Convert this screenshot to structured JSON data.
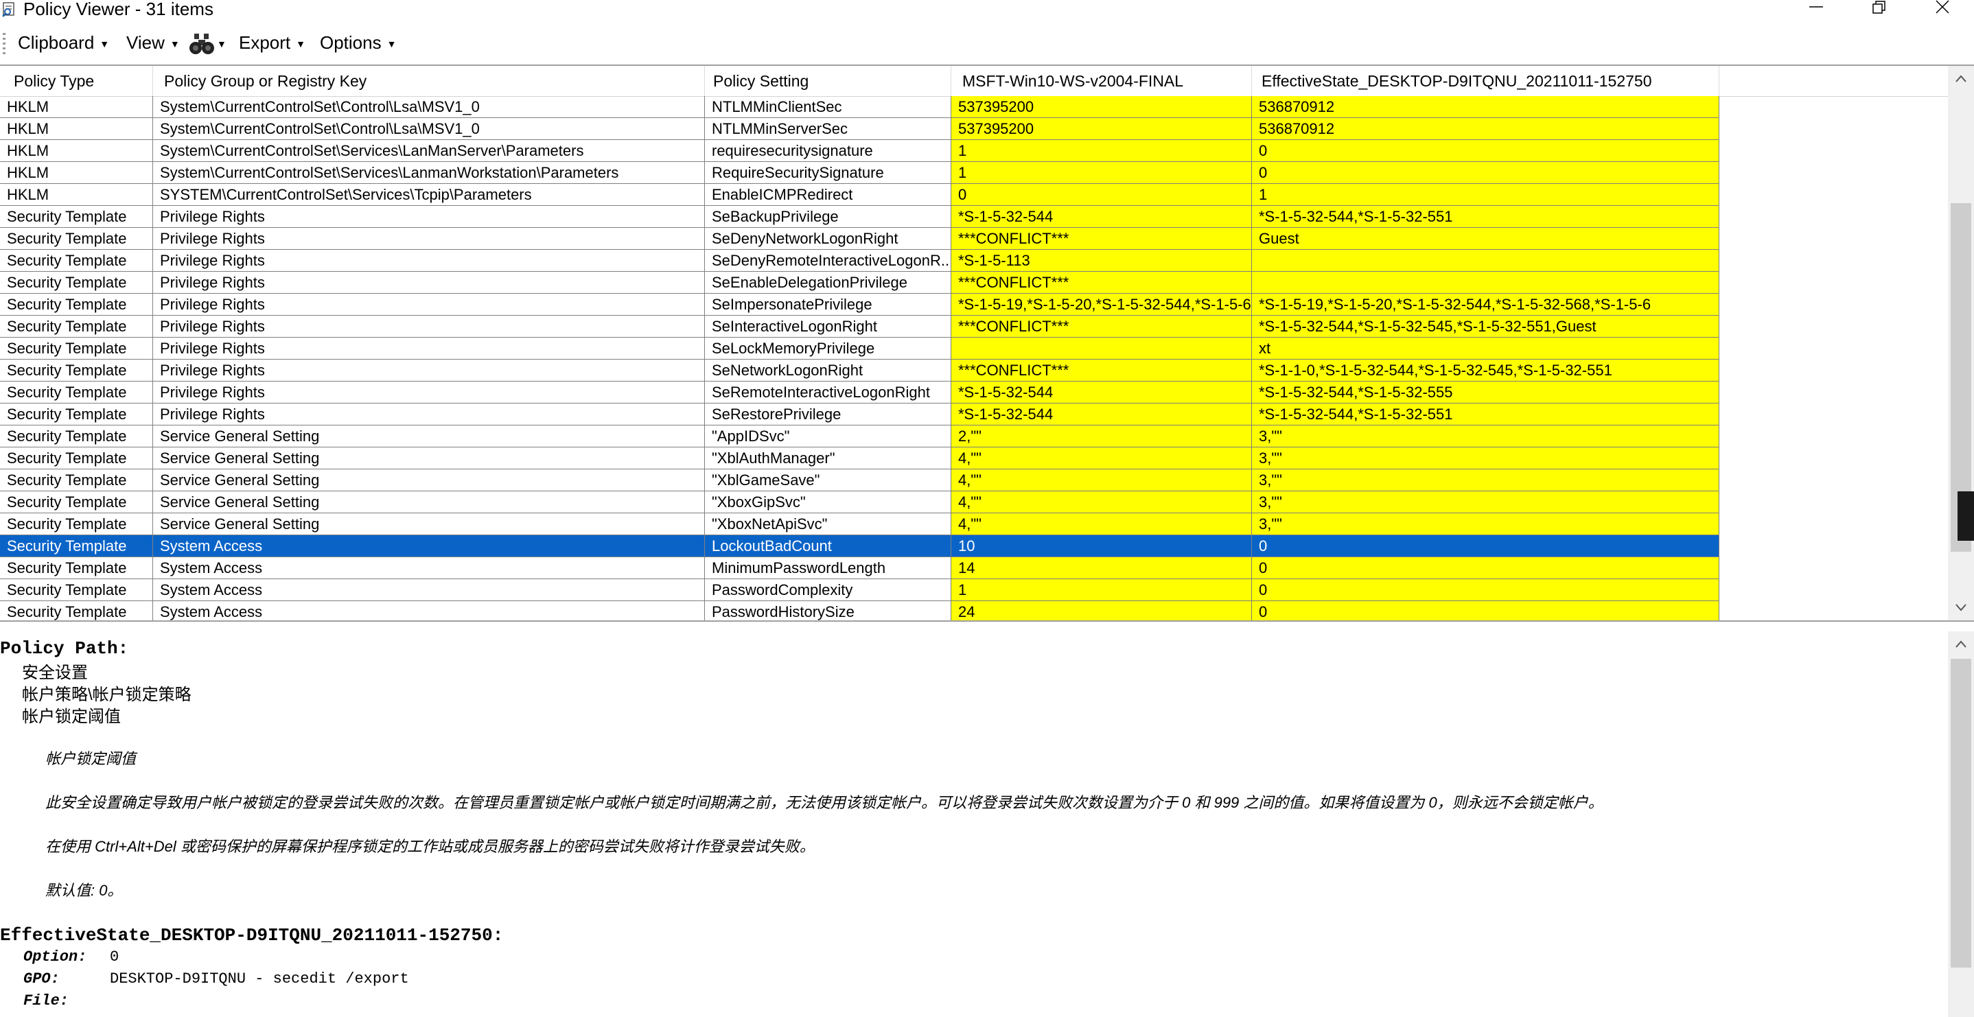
{
  "window": {
    "title": "Policy Viewer - 31 items"
  },
  "menu": {
    "clipboard": "Clipboard",
    "view": "View",
    "find_icon": "binoculars-icon",
    "export": "Export",
    "options": "Options"
  },
  "grid": {
    "columns": [
      "Policy Type",
      "Policy Group or Registry Key",
      "Policy Setting",
      "MSFT-Win10-WS-v2004-FINAL",
      "EffectiveState_DESKTOP-D9ITQNU_20211011-152750"
    ],
    "rows": [
      [
        "HKLM",
        "System\\CurrentControlSet\\Control\\Lsa\\MSV1_0",
        "NTLMMinClientSec",
        "537395200",
        "536870912"
      ],
      [
        "HKLM",
        "System\\CurrentControlSet\\Control\\Lsa\\MSV1_0",
        "NTLMMinServerSec",
        "537395200",
        "536870912"
      ],
      [
        "HKLM",
        "System\\CurrentControlSet\\Services\\LanManServer\\Parameters",
        "requiresecuritysignature",
        "1",
        "0"
      ],
      [
        "HKLM",
        "System\\CurrentControlSet\\Services\\LanmanWorkstation\\Parameters",
        "RequireSecuritySignature",
        "1",
        "0"
      ],
      [
        "HKLM",
        "SYSTEM\\CurrentControlSet\\Services\\Tcpip\\Parameters",
        "EnableICMPRedirect",
        "0",
        "1"
      ],
      [
        "Security Template",
        "Privilege Rights",
        "SeBackupPrivilege",
        "*S-1-5-32-544",
        "*S-1-5-32-544,*S-1-5-32-551"
      ],
      [
        "Security Template",
        "Privilege Rights",
        "SeDenyNetworkLogonRight",
        "***CONFLICT***",
        "Guest"
      ],
      [
        "Security Template",
        "Privilege Rights",
        "SeDenyRemoteInteractiveLogonR...",
        "*S-1-5-113",
        ""
      ],
      [
        "Security Template",
        "Privilege Rights",
        "SeEnableDelegationPrivilege",
        "***CONFLICT***",
        ""
      ],
      [
        "Security Template",
        "Privilege Rights",
        "SeImpersonatePrivilege",
        "*S-1-5-19,*S-1-5-20,*S-1-5-32-544,*S-1-5-6",
        "*S-1-5-19,*S-1-5-20,*S-1-5-32-544,*S-1-5-32-568,*S-1-5-6"
      ],
      [
        "Security Template",
        "Privilege Rights",
        "SeInteractiveLogonRight",
        "***CONFLICT***",
        "*S-1-5-32-544,*S-1-5-32-545,*S-1-5-32-551,Guest"
      ],
      [
        "Security Template",
        "Privilege Rights",
        "SeLockMemoryPrivilege",
        "",
        "xt"
      ],
      [
        "Security Template",
        "Privilege Rights",
        "SeNetworkLogonRight",
        "***CONFLICT***",
        "*S-1-1-0,*S-1-5-32-544,*S-1-5-32-545,*S-1-5-32-551"
      ],
      [
        "Security Template",
        "Privilege Rights",
        "SeRemoteInteractiveLogonRight",
        "*S-1-5-32-544",
        "*S-1-5-32-544,*S-1-5-32-555"
      ],
      [
        "Security Template",
        "Privilege Rights",
        "SeRestorePrivilege",
        "*S-1-5-32-544",
        "*S-1-5-32-544,*S-1-5-32-551"
      ],
      [
        "Security Template",
        "Service General Setting",
        "\"AppIDSvc\"",
        "2,\"\"",
        "3,\"\""
      ],
      [
        "Security Template",
        "Service General Setting",
        "\"XblAuthManager\"",
        "4,\"\"",
        "3,\"\""
      ],
      [
        "Security Template",
        "Service General Setting",
        "\"XblGameSave\"",
        "4,\"\"",
        "3,\"\""
      ],
      [
        "Security Template",
        "Service General Setting",
        "\"XboxGipSvc\"",
        "4,\"\"",
        "3,\"\""
      ],
      [
        "Security Template",
        "Service General Setting",
        "\"XboxNetApiSvc\"",
        "4,\"\"",
        "3,\"\""
      ],
      [
        "Security Template",
        "System Access",
        "LockoutBadCount",
        "10",
        "0"
      ],
      [
        "Security Template",
        "System Access",
        "MinimumPasswordLength",
        "14",
        "0"
      ],
      [
        "Security Template",
        "System Access",
        "PasswordComplexity",
        "1",
        "0"
      ],
      [
        "Security Template",
        "System Access",
        "PasswordHistorySize",
        "24",
        "0"
      ]
    ],
    "selected_row_index": 20,
    "highlight_color": "#ffff00",
    "selection_color": "#0a64c8"
  },
  "details": {
    "path_label": "Policy Path:",
    "path_items": [
      "安全设置",
      "帐户策略\\帐户锁定策略",
      "帐户锁定阈值"
    ],
    "desc_title": "帐户锁定阈值",
    "desc_body": "此安全设置确定导致用户帐户被锁定的登录尝试失败的次数。在管理员重置锁定帐户或帐户锁定时间期满之前，无法使用该锁定帐户。可以将登录尝试失败次数设置为介于 0 和 999 之间的值。如果将值设置为 0，则永远不会锁定帐户。",
    "desc_note": "在使用 Ctrl+Alt+Del 或密码保护的屏幕保护程序锁定的工作站或成员服务器上的密码尝试失败将计作登录尝试失败。",
    "desc_default": "默认值: 0。",
    "state_label": "EffectiveState_DESKTOP-D9ITQNU_20211011-152750:",
    "option_key": "Option:",
    "option_value": "0",
    "gpo_key": "GPO:",
    "gpo_value": "DESKTOP-D9ITQNU - secedit /export",
    "file_key": "File:"
  }
}
